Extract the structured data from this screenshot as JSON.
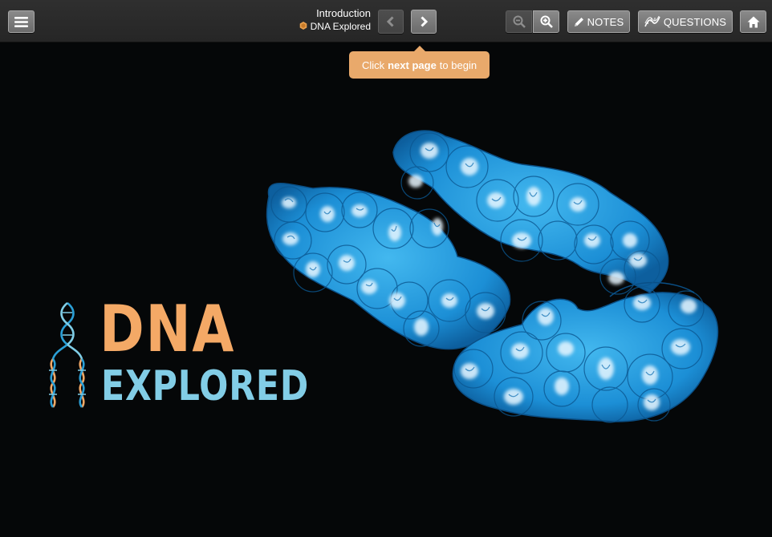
{
  "header": {
    "title": "Introduction",
    "subtitle": "DNA Explored",
    "notes_label": "NOTES",
    "questions_label": "QUESTIONS"
  },
  "tooltip": {
    "prefix": "Click",
    "bold": "next page",
    "suffix": "to begin"
  },
  "logo": {
    "line1": "DNA",
    "line2": "EXPLORED"
  },
  "icons": {
    "menu": "hamburger-menu-icon",
    "prev": "chevron-left-icon",
    "next": "chevron-right-icon",
    "zoom_out": "zoom-out-icon",
    "zoom_in": "zoom-in-icon",
    "notes": "pencil-icon",
    "questions": "dna-strand-icon",
    "home": "home-icon",
    "subtitle": "hexagon-icon"
  },
  "colors": {
    "topbar": "#2b2b2b",
    "button": "#7a7a7a",
    "tooltip": "#e9a96b",
    "logo_orange": "#f4a966",
    "logo_blue": "#82cde6",
    "cell_blue": "#1b8fd4",
    "background": "#050708"
  }
}
